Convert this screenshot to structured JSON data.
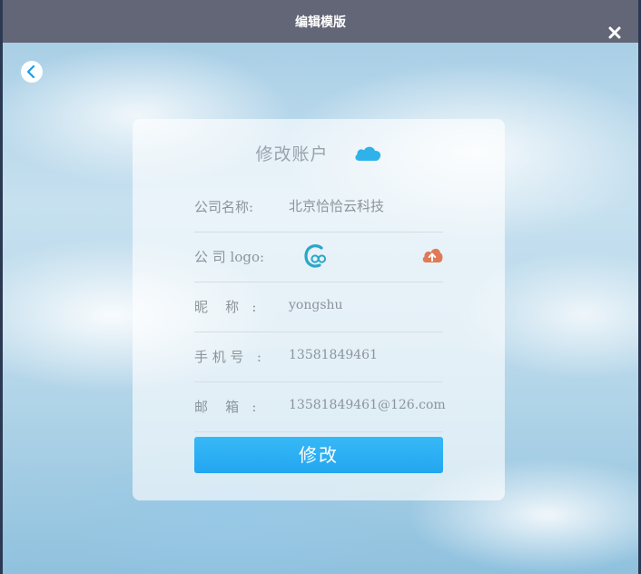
{
  "dialog": {
    "title": "编辑模版",
    "close_icon": "close-icon",
    "back_icon": "chevron-left-icon"
  },
  "form": {
    "title": "修改账户",
    "title_icon": "cloud-icon",
    "fields": [
      {
        "label": "公司名称:",
        "value": "北京恰恰云科技"
      },
      {
        "label": "公 司 logo:",
        "value": "",
        "logo_icon": "company-logo-icon",
        "upload_icon": "cloud-upload-icon"
      },
      {
        "label": "昵    称   :",
        "value": "yongshu"
      },
      {
        "label": "手 机 号   :",
        "value": "13581849461"
      },
      {
        "label": "邮    箱   :",
        "value": "13581849461@126.com"
      }
    ],
    "submit_label": "修改"
  },
  "colors": {
    "titlebar": "#636677",
    "accent": "#29aaf2",
    "upload_icon": "#e07a56",
    "cloud_icon": "#2fb2ea"
  }
}
